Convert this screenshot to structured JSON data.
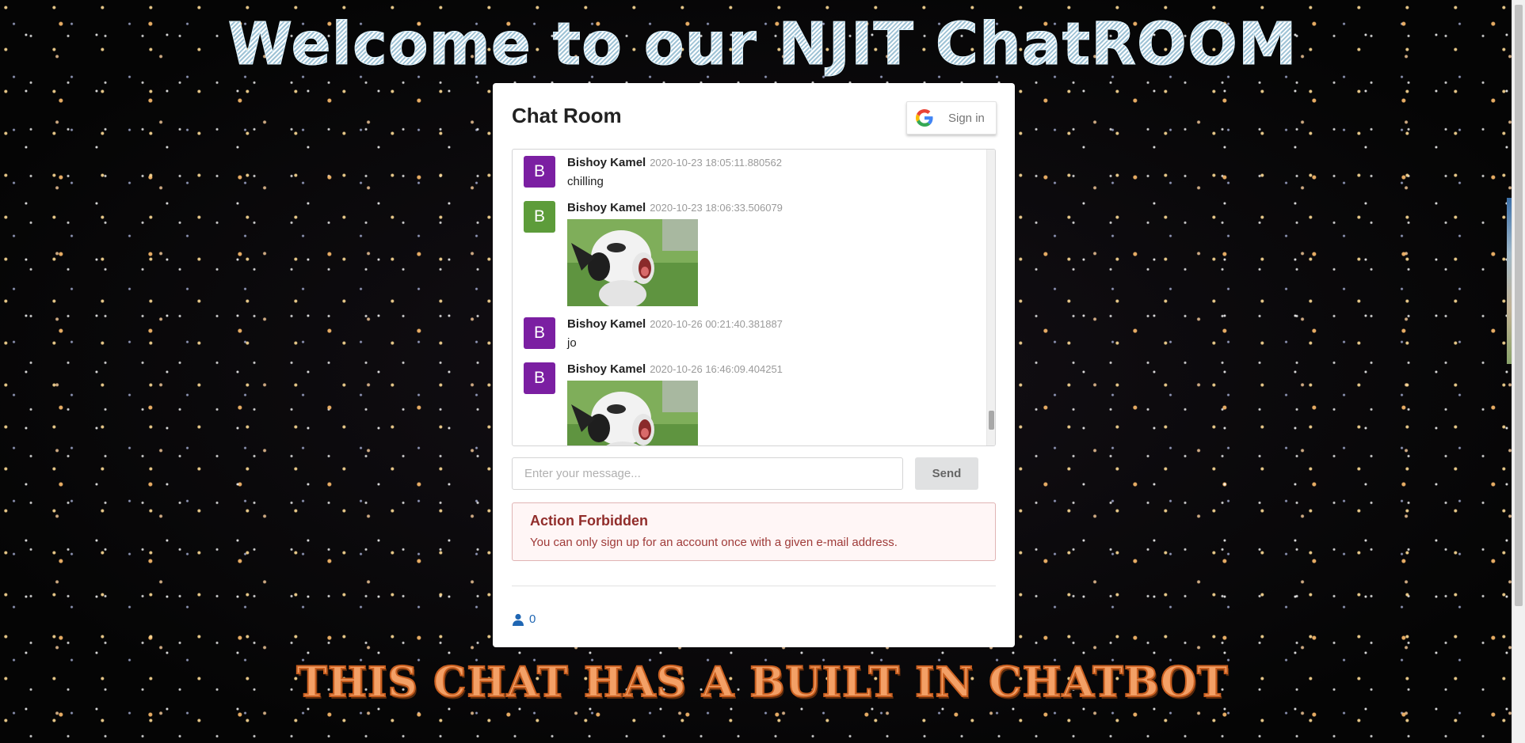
{
  "page": {
    "welcome_heading": "Welcome to our NJIT ChatROOM",
    "chatbot_banner": "THIS CHAT HAS A BUILT IN CHATBOT"
  },
  "chat": {
    "title": "Chat Room",
    "signin_label": "Sign in",
    "messages": [
      {
        "avatar": "B",
        "avatar_color": "#7b1fa2",
        "author": "Bishoy Kamel",
        "timestamp": "2020-10-23 18:05:11.880562",
        "text": "chilling",
        "image": ""
      },
      {
        "avatar": "B",
        "avatar_color": "#5d9c3a",
        "author": "Bishoy Kamel",
        "timestamp": "2020-10-23 18:06:33.506079",
        "text": "",
        "image": "alpaca-photo"
      },
      {
        "avatar": "B",
        "avatar_color": "#7b1fa2",
        "author": "Bishoy Kamel",
        "timestamp": "2020-10-26 00:21:40.381887",
        "text": "jo",
        "image": ""
      },
      {
        "avatar": "B",
        "avatar_color": "#7b1fa2",
        "author": "Bishoy Kamel",
        "timestamp": "2020-10-26 16:46:09.404251",
        "text": "",
        "image": "alpaca-photo"
      }
    ],
    "input_placeholder": "Enter your message...",
    "send_label": "Send",
    "error": {
      "header": "Action Forbidden",
      "text": "You can only sign up for an account once with a given e-mail address."
    },
    "user_count": "0"
  },
  "icons": {
    "google": "google-g-icon",
    "user": "user-icon"
  },
  "colors": {
    "avatar_purple": "#7b1fa2",
    "avatar_green": "#5d9c3a",
    "error_bg": "#fff6f6",
    "error_border": "#e0b4b4",
    "error_text": "#9f3a38",
    "link_blue": "#1f66b3",
    "banner_orange": "#f3a066"
  }
}
